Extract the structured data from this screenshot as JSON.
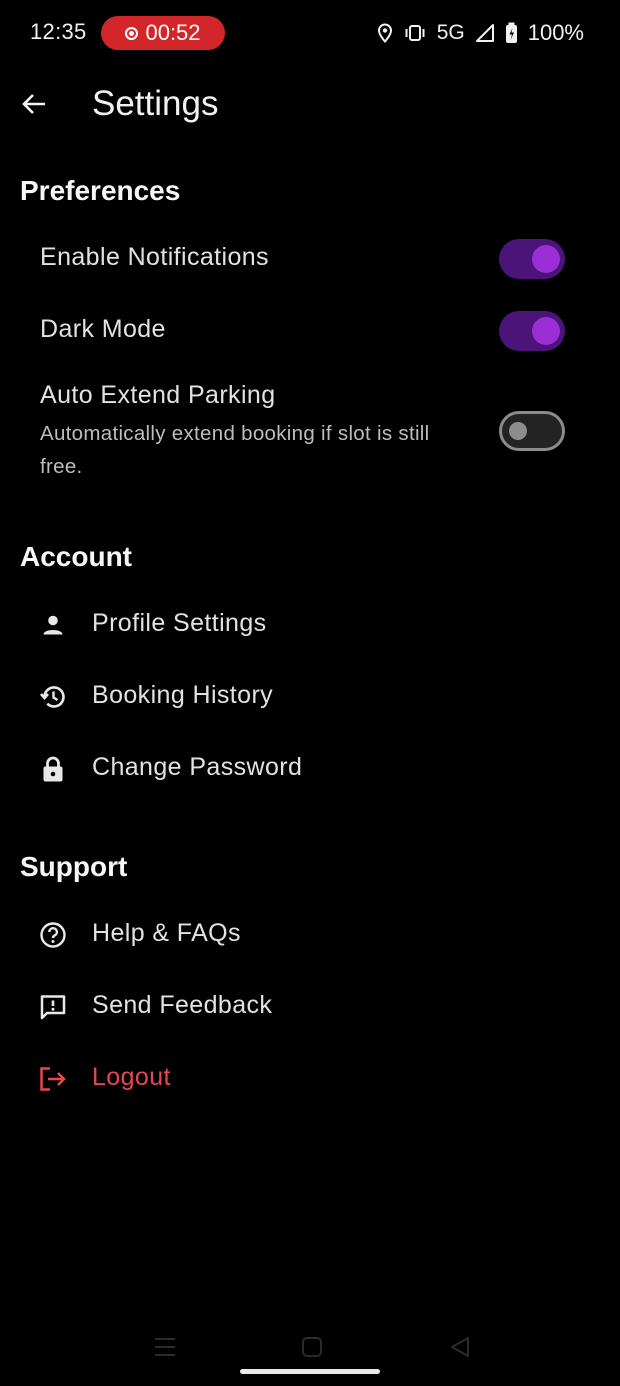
{
  "status_bar": {
    "time": "12:35",
    "recording_time": "00:52",
    "network": "5G",
    "battery": "100%"
  },
  "app_bar": {
    "title": "Settings"
  },
  "preferences": {
    "title": "Preferences",
    "items": [
      {
        "label": "Enable Notifications",
        "enabled": true
      },
      {
        "label": "Dark Mode",
        "enabled": true
      },
      {
        "label": "Auto Extend Parking",
        "subtitle": "Automatically extend booking if slot is still free.",
        "enabled": false
      }
    ]
  },
  "account": {
    "title": "Account",
    "items": [
      {
        "label": "Profile Settings",
        "icon": "person-icon"
      },
      {
        "label": "Booking History",
        "icon": "history-icon"
      },
      {
        "label": "Change Password",
        "icon": "lock-icon"
      }
    ]
  },
  "support": {
    "title": "Support",
    "items": [
      {
        "label": "Help & FAQs",
        "icon": "help-icon"
      },
      {
        "label": "Send Feedback",
        "icon": "feedback-icon"
      },
      {
        "label": "Logout",
        "icon": "logout-icon"
      }
    ]
  },
  "colors": {
    "accent": "#9a2fd6",
    "toggle_track_on": "#4a1478",
    "danger": "#e5484d",
    "record_pill": "#d3262b",
    "background": "#000000"
  }
}
